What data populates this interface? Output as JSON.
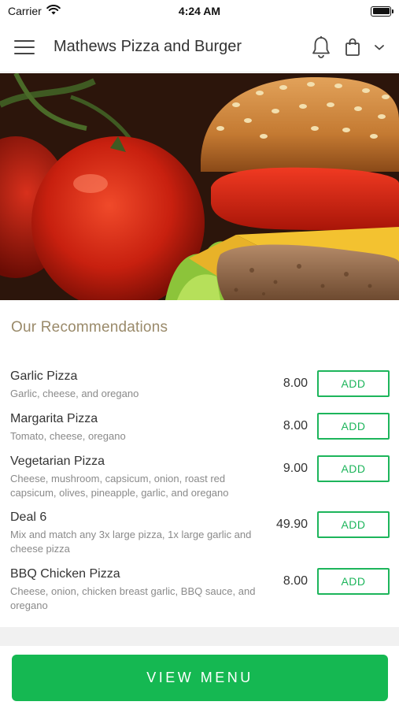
{
  "status_bar": {
    "carrier": "Carrier",
    "time": "4:24 AM"
  },
  "header": {
    "title": "Mathews Pizza and Burger"
  },
  "section": {
    "title": "Our Recommendations"
  },
  "items": [
    {
      "name": "Garlic Pizza",
      "description": "Garlic, cheese, and oregano",
      "price": "8.00",
      "add_label": "ADD"
    },
    {
      "name": "Margarita Pizza",
      "description": "Tomato, cheese, oregano",
      "price": "8.00",
      "add_label": "ADD"
    },
    {
      "name": "Vegetarian Pizza",
      "description": "Cheese, mushroom, capsicum, onion, roast red capsicum, olives, pineapple, garlic, and oregano",
      "price": "9.00",
      "add_label": "ADD"
    },
    {
      "name": "Deal 6",
      "description": "Mix and match any 3x large pizza, 1x large garlic and cheese pizza",
      "price": "49.90",
      "add_label": "ADD"
    },
    {
      "name": "BBQ Chicken Pizza",
      "description": "Cheese, onion, chicken breast garlic, BBQ sauce, and oregano",
      "price": "8.00",
      "add_label": "ADD"
    }
  ],
  "footer": {
    "view_menu_label": "VIEW MENU"
  },
  "colors": {
    "accent_green": "#15b852",
    "section_title": "#9a8a6a"
  }
}
